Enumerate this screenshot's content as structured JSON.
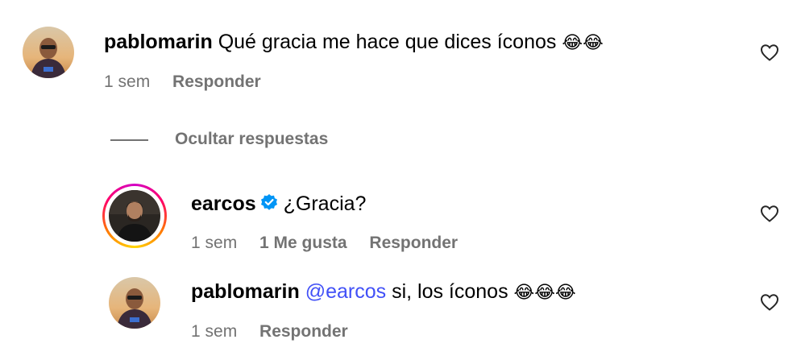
{
  "comments": [
    {
      "username": "pablomarin",
      "text": "Qué gracia me hace que dices íconos",
      "emoji": "😂😂",
      "time": "1 sem",
      "reply": "Responder"
    }
  ],
  "replies_toggle": "Ocultar respuestas",
  "replies": [
    {
      "username": "earcos",
      "text": "¿Gracia?",
      "time": "1 sem",
      "likes": "1 Me gusta",
      "reply": "Responder"
    },
    {
      "username": "pablomarin",
      "mention": "@earcos",
      "text": "si, los íconos",
      "emoji": "😂😂😂",
      "time": "1 sem",
      "reply": "Responder"
    }
  ],
  "colors": {
    "mention": "#4150f7",
    "meta": "#737373",
    "verified": "#0095f6"
  }
}
